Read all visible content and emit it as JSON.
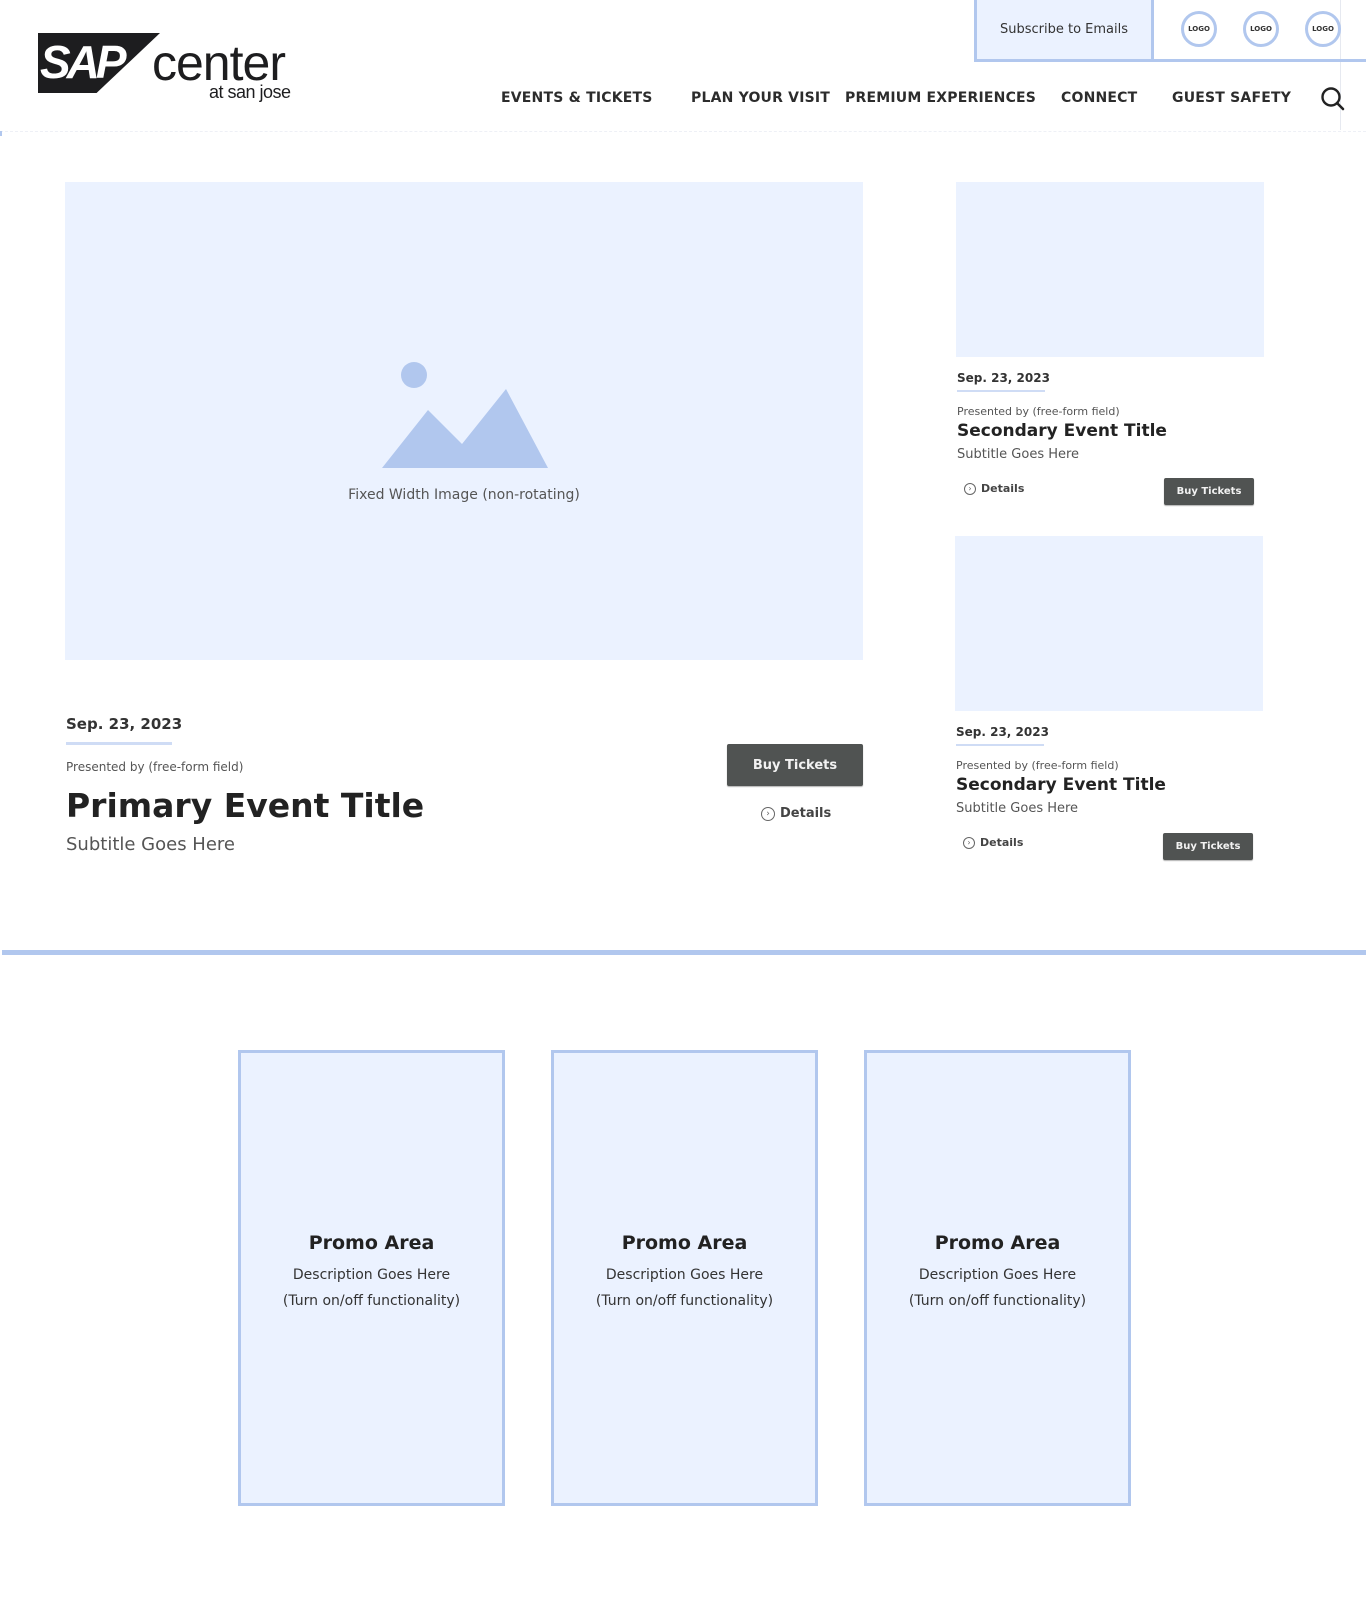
{
  "brand": {
    "logo_mark": "SAP",
    "logo_word": "center",
    "logo_sub": "at san jose"
  },
  "topbar": {
    "subscribe_label": "Subscribe to Emails",
    "partner_logos": [
      "LOGO",
      "LOGO",
      "LOGO"
    ]
  },
  "nav": {
    "items": [
      "EVENTS & TICKETS",
      "PLAN YOUR VISIT",
      "PREMIUM EXPERIENCES",
      "CONNECT",
      "GUEST SAFETY"
    ],
    "search_icon": "search-icon"
  },
  "colors": {
    "accent": "#b1c7ee",
    "placeholder_bg": "#ebf2ff",
    "button_bg": "#505352"
  },
  "primary_event": {
    "image_caption": "Fixed Width Image (non-rotating)",
    "date": "Sep. 23, 2023",
    "presented_by": "Presented by (free-form field)",
    "title": "Primary Event Title",
    "subtitle": "Subtitle Goes Here",
    "buy_label": "Buy Tickets",
    "details_label": "Details"
  },
  "secondary_events": [
    {
      "date": "Sep. 23, 2023",
      "presented_by": "Presented by (free-form field)",
      "title": "Secondary Event Title",
      "subtitle": "Subtitle Goes Here",
      "details_label": "Details",
      "buy_label": "Buy Tickets"
    },
    {
      "date": "Sep. 23, 2023",
      "presented_by": "Presented by (free-form field)",
      "title": "Secondary Event Title",
      "subtitle": "Subtitle Goes Here",
      "details_label": "Details",
      "buy_label": "Buy Tickets"
    }
  ],
  "promos": [
    {
      "title": "Promo Area",
      "description": "Description Goes Here",
      "note": "(Turn on/off functionality)"
    },
    {
      "title": "Promo Area",
      "description": "Description Goes Here",
      "note": "(Turn on/off functionality)"
    },
    {
      "title": "Promo Area",
      "description": "Description Goes Here",
      "note": "(Turn on/off functionality)"
    }
  ]
}
